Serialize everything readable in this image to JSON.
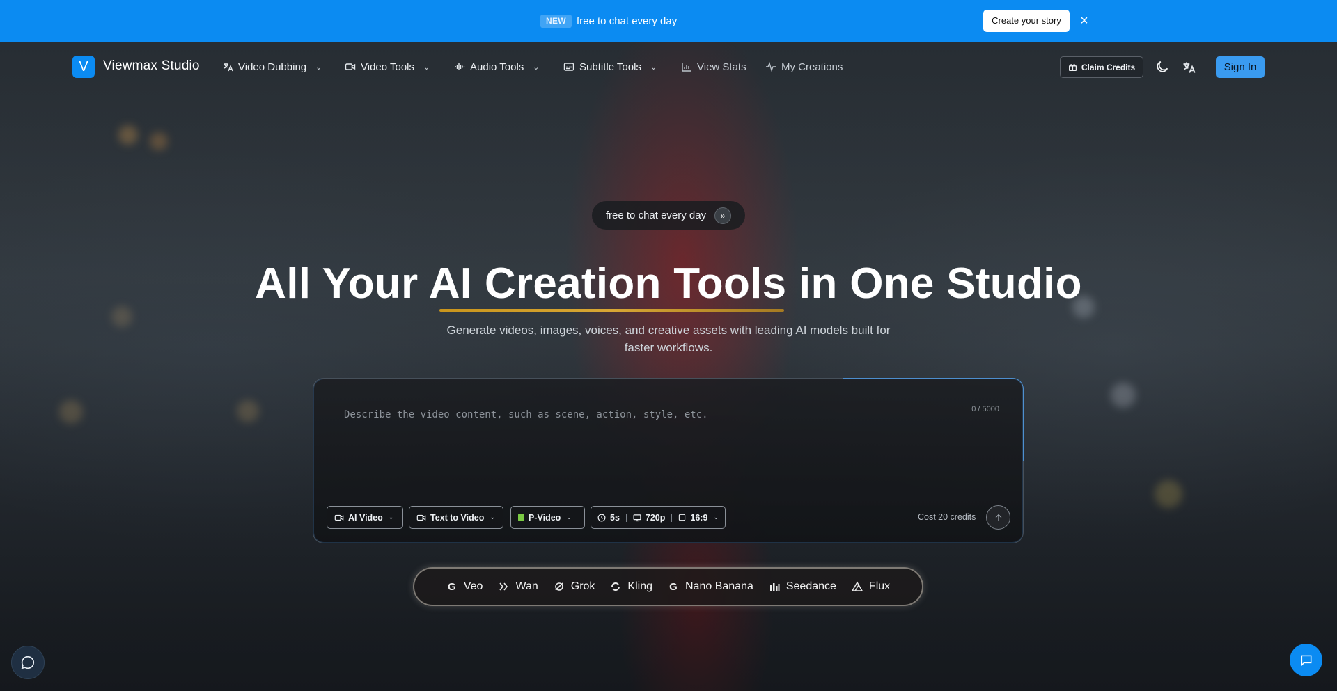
{
  "banner": {
    "badge": "NEW",
    "text": "free to chat every day",
    "cta": "Create your story",
    "close": "×"
  },
  "brand": {
    "logo_letter": "V",
    "name": "Viewmax Studio"
  },
  "nav": {
    "items": [
      {
        "label": "Video Dubbing",
        "icon": "translate-icon",
        "dropdown": true
      },
      {
        "label": "Video Tools",
        "icon": "video-camera-icon",
        "dropdown": true
      },
      {
        "label": "Audio Tools",
        "icon": "audio-wave-icon",
        "dropdown": true
      },
      {
        "label": "Subtitle Tools",
        "icon": "captions-icon",
        "dropdown": true
      },
      {
        "label": "View Stats",
        "icon": "bar-chart-icon",
        "dropdown": false
      },
      {
        "label": "My Creations",
        "icon": "activity-icon",
        "dropdown": false
      }
    ],
    "claim_credits": "Claim Credits",
    "sign_in": "Sign In"
  },
  "hero": {
    "pill_text": "free to chat every day",
    "title": "All Your AI Creation Tools in One Studio",
    "subtitle": "Generate videos, images, voices, and creative assets with leading AI models built for faster workflows."
  },
  "prompt": {
    "placeholder": "Describe the video content, such as scene, action, style, etc.",
    "value": "",
    "counter": "0 / 5000",
    "chips": {
      "mode": "AI Video",
      "type": "Text to Video",
      "model": "P-Video",
      "duration": "5s",
      "resolution": "720p",
      "ratio": "16:9"
    },
    "cost": "Cost 20 credits"
  },
  "models": [
    {
      "name": "Veo",
      "icon": "google-icon"
    },
    {
      "name": "Wan",
      "icon": "wan-icon"
    },
    {
      "name": "Grok",
      "icon": "grok-icon"
    },
    {
      "name": "Kling",
      "icon": "kling-icon"
    },
    {
      "name": "Nano Banana",
      "icon": "google-icon"
    },
    {
      "name": "Seedance",
      "icon": "seedance-icon"
    },
    {
      "name": "Flux",
      "icon": "flux-icon"
    }
  ],
  "colors": {
    "banner": "#0b8bf2",
    "accent": "#3a9bf0",
    "underline": "#d8a734"
  }
}
